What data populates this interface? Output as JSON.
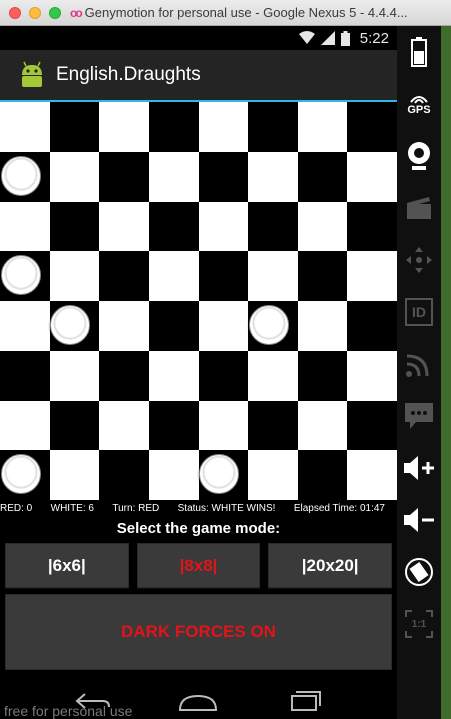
{
  "window": {
    "title": "Genymotion for personal use - Google Nexus 5 - 4.4.4..."
  },
  "statusbar": {
    "time": "5:22"
  },
  "app": {
    "title": "English.Draughts"
  },
  "board": {
    "size": 8,
    "white_pieces": [
      [
        1,
        0
      ],
      [
        3,
        0
      ],
      [
        4,
        1
      ],
      [
        4,
        5
      ],
      [
        7,
        0
      ],
      [
        7,
        4
      ]
    ]
  },
  "info": {
    "red": "RED: 0",
    "white": "WHITE: 6",
    "turn": "Turn: RED",
    "status": "Status: WHITE WINS!",
    "elapsed": "Elapsed Time: 01:47"
  },
  "mode": {
    "label": "Select the game mode:",
    "buttons": [
      "|6x6|",
      "|8x8|",
      "|20x20|"
    ],
    "active_index": 1
  },
  "dark_forces": {
    "label": "DARK FORCES ON"
  },
  "watermark": "free for personal use",
  "sidebar": {
    "gps_label": "GPS",
    "id_label": "ID",
    "scale_label": "1:1"
  },
  "colors": {
    "accent": "#33b5e5",
    "red_text": "#e0141a"
  }
}
